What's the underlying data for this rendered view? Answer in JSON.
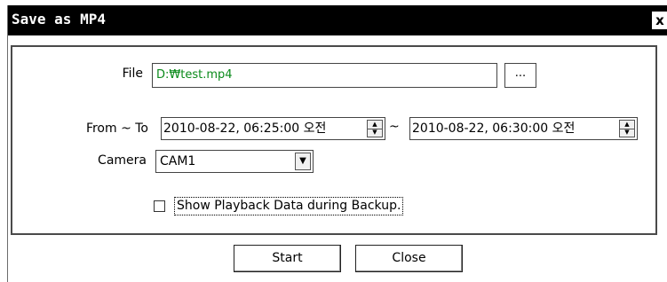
{
  "window": {
    "title": "Save as MP4",
    "close_glyph": "x"
  },
  "form": {
    "file_label": "File",
    "file_value": "D:₩test.mp4",
    "browse_label": "...",
    "range_label": "From ~ To",
    "range_separator": "~",
    "from_value": "2010-08-22, 06:25:00 오전",
    "to_value": "2010-08-22, 06:30:00 오전",
    "camera_label": "Camera",
    "camera_selected": "CAM1",
    "show_playback_label": "Show Playback Data during Backup.",
    "show_playback_checked": false
  },
  "buttons": {
    "start": "Start",
    "close": "Close"
  },
  "icons": {
    "spin_up": "▲",
    "spin_down": "▼",
    "dropdown": "▼"
  }
}
